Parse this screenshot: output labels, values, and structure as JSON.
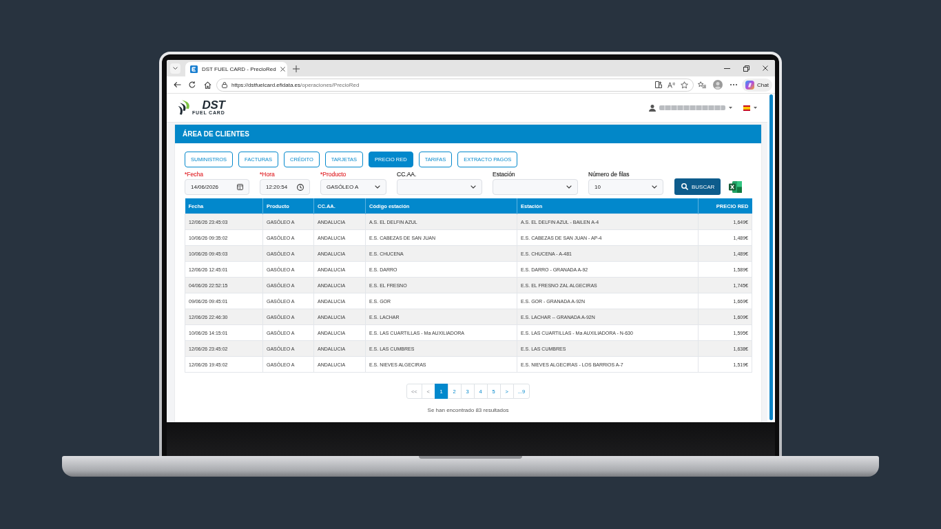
{
  "browser": {
    "tab": {
      "title": "DST FUEL CARD - PrecioRed"
    },
    "address_bar": {
      "host": "https://dstfuelcard.efidata.es",
      "path": "/operaciones/PrecioRed"
    },
    "chat_button": "Chat"
  },
  "header": {
    "logo": {
      "name": "DST",
      "tagline": "FUEL CARD"
    }
  },
  "card": {
    "title": "ÁREA DE CLIENTES",
    "tabs": [
      {
        "label": "SUMINISTROS",
        "selected": false
      },
      {
        "label": "FACTURAS",
        "selected": false
      },
      {
        "label": "CRÉDITO",
        "selected": false
      },
      {
        "label": "TARJETAS",
        "selected": false
      },
      {
        "label": "PRECIO RED",
        "selected": true
      },
      {
        "label": "TARIFAS",
        "selected": false
      },
      {
        "label": "EXTRACTO PAGOS",
        "selected": false
      }
    ],
    "filters": [
      {
        "label": "*Fecha",
        "required": true,
        "kind": "date",
        "value": "14/06/2026"
      },
      {
        "label": "*Hora",
        "required": true,
        "kind": "time",
        "value": "12:20:54"
      },
      {
        "label": "*Producto",
        "required": true,
        "kind": "select",
        "value": "GASÓLEO A"
      },
      {
        "label": "CC.AA.",
        "required": false,
        "kind": "select"
      },
      {
        "label": "Estación",
        "required": false,
        "kind": "select"
      },
      {
        "label": "Número de filas",
        "required": false,
        "kind": "select",
        "value": "10"
      }
    ],
    "search_button": "BUSCAR",
    "table": {
      "columns": [
        "Fecha",
        "Producto",
        "CC.AA.",
        "Código estación",
        "Estación",
        "PRECIO RED"
      ],
      "rows": [
        [
          "12/06/26 23:45:03",
          "GASÓLEO A",
          "ANDALUCIA",
          "A.S. EL DELFIN AZUL",
          "A.S. EL DELFIN AZUL - BAILEN A-4",
          "1,649€"
        ],
        [
          "10/06/26 09:35:02",
          "GASÓLEO A",
          "ANDALUCIA",
          "E.S. CABEZAS DE SAN JUAN",
          "E.S. CABEZAS DE SAN JUAN - AP-4",
          "1,489€"
        ],
        [
          "10/06/26 09:45:03",
          "GASÓLEO A",
          "ANDALUCIA",
          "E.S. CHUCENA",
          "E.S. CHUCENA - A-481",
          "1,489€"
        ],
        [
          "12/06/26 12:45:01",
          "GASÓLEO A",
          "ANDALUCIA",
          "E.S. DARRO",
          "E.S. DARRO - GRANADA A-92",
          "1,589€"
        ],
        [
          "04/06/26 22:52:15",
          "GASÓLEO A",
          "ANDALUCIA",
          "E.S. EL FRESNO",
          "E.S. EL FRESNO ZAL ALGECIRAS",
          "1,745€"
        ],
        [
          "09/06/26 09:45:01",
          "GASÓLEO A",
          "ANDALUCIA",
          "E.S. GOR",
          "E.S. GOR - GRANADA A-92N",
          "1,669€"
        ],
        [
          "12/06/26 22:46:30",
          "GASÓLEO A",
          "ANDALUCIA",
          "E.S. LACHAR",
          "E.S. LACHAR -- GRANADA A-92N",
          "1,609€"
        ],
        [
          "10/06/26 14:15:01",
          "GASÓLEO A",
          "ANDALUCIA",
          "E.S. LAS CUARTILLAS - Ma AUXILIADORA",
          "E.S. LAS CUARTILLAS - Ma AUXILIADORA - N-630",
          "1,595€"
        ],
        [
          "12/06/26 23:45:02",
          "GASÓLEO A",
          "ANDALUCIA",
          "E.S. LAS CUMBRES",
          "E.S. LAS CUMBRES",
          "1,638€"
        ],
        [
          "12/06/26 19:45:02",
          "GASÓLEO A",
          "ANDALUCIA",
          "E.S. NIEVES ALGECIRAS",
          "E.S. NIEVES ALGECIRAS - LOS BARRIOS A-7",
          "1,519€"
        ]
      ]
    },
    "pagination": [
      {
        "label": "<<",
        "selected": false,
        "disabled": true
      },
      {
        "label": "<",
        "selected": false,
        "disabled": true
      },
      {
        "label": "1",
        "selected": true,
        "disabled": false
      },
      {
        "label": "2",
        "selected": false,
        "disabled": false
      },
      {
        "label": "3",
        "selected": false,
        "disabled": false
      },
      {
        "label": "4",
        "selected": false,
        "disabled": false
      },
      {
        "label": "5",
        "selected": false,
        "disabled": false
      },
      {
        "label": ">",
        "selected": false,
        "disabled": false
      },
      {
        "label": "...9",
        "selected": false,
        "disabled": false
      }
    ],
    "results": "Se han encontrado 83 resultados"
  }
}
